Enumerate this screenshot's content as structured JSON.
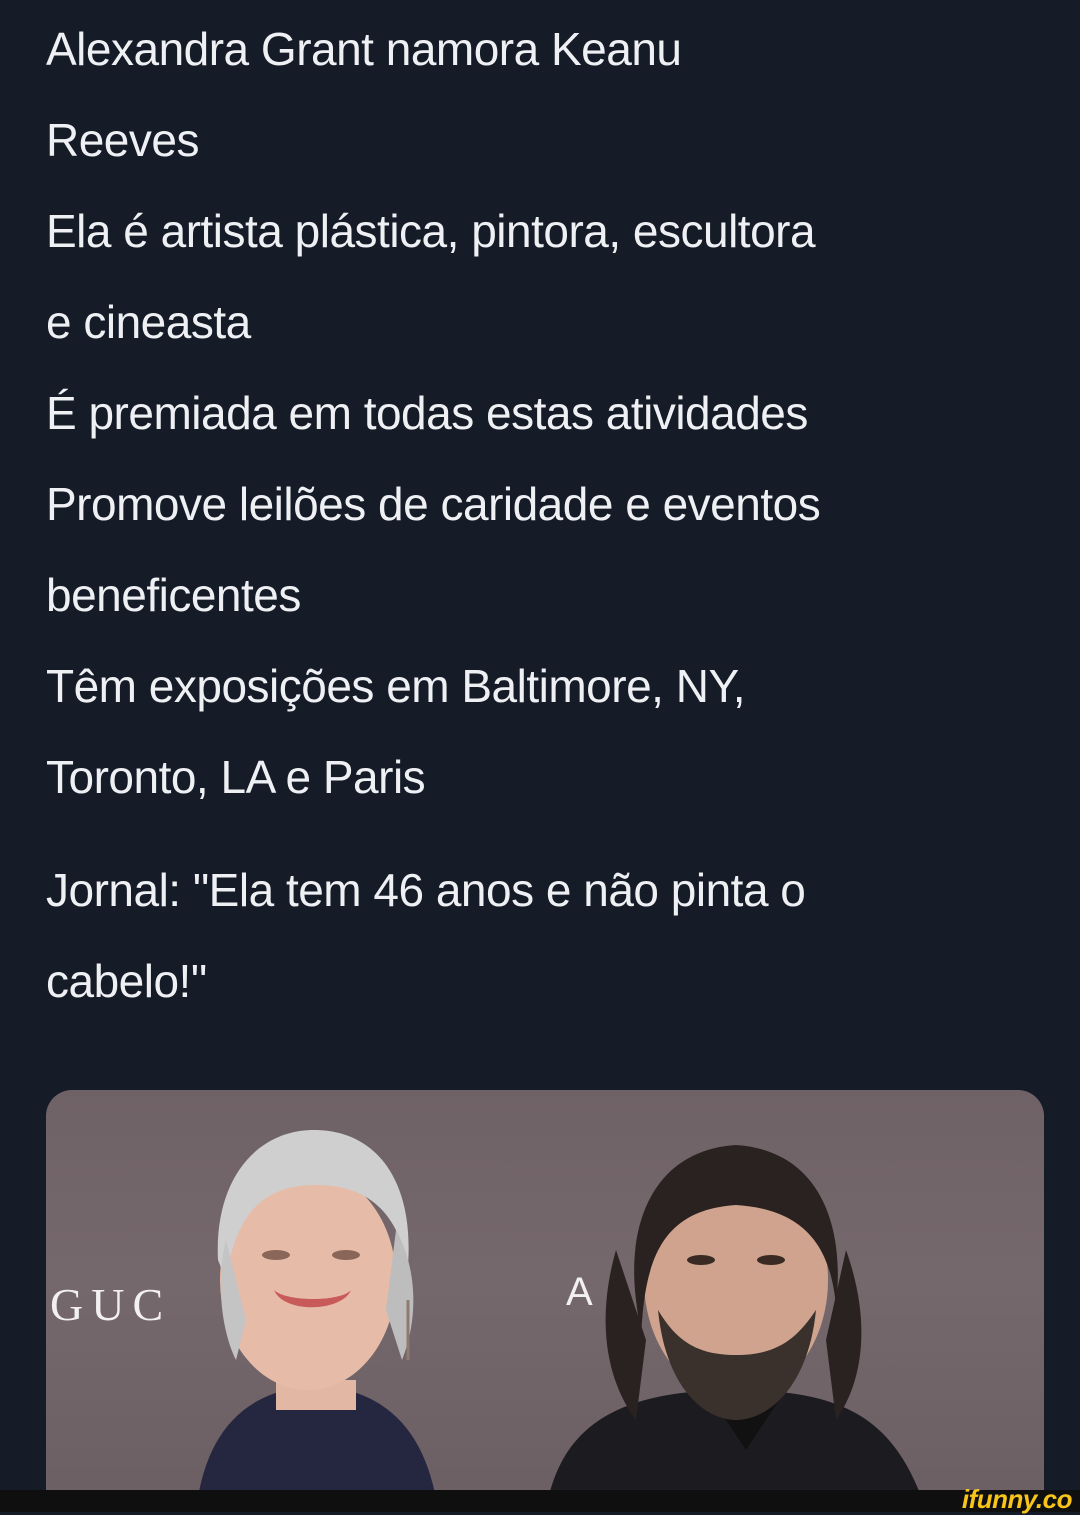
{
  "post": {
    "lines": [
      "Alexandra Grant namora Keanu",
      "Reeves",
      "Ela é artista plástica, pintora, escultora",
      "e cineasta",
      "É premiada em todas estas atividades",
      "Promove leilões de caridade e eventos",
      "beneficentes",
      "Têm exposições em Baltimore, NY,",
      "Toronto, LA e Paris"
    ],
    "punchline_lines": [
      "Jornal: \"Ela tem 46 anos e não pinta o",
      "cabelo!\""
    ]
  },
  "photo": {
    "backdrop_text_left": "GUC",
    "backdrop_text_right": "A",
    "backdrop_color": "#716468"
  },
  "watermark": {
    "text": "ifunny.co",
    "color": "#f7c51a"
  },
  "colors": {
    "background": "#151b27",
    "text": "#eef0f3"
  }
}
